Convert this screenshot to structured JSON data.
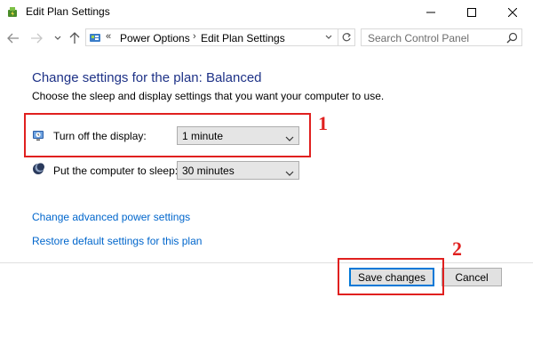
{
  "window": {
    "title": "Edit Plan Settings",
    "controls": [
      "minimize",
      "maximize",
      "close"
    ]
  },
  "navigation": {
    "breadcrumb_chevrons": "«",
    "breadcrumbs": [
      "Power Options",
      "Edit Plan Settings"
    ],
    "breadcrumb_separator": "›",
    "search_placeholder": "Search Control Panel"
  },
  "main": {
    "title": "Change settings for the plan: Balanced",
    "description": "Choose the sleep and display settings that you want your computer to use.",
    "settings": [
      {
        "label": "Turn off the display:",
        "value": "1 minute",
        "icon": "display-clock-icon"
      },
      {
        "label": "Put the computer to sleep:",
        "value": "30 minutes",
        "icon": "moon-sleep-icon"
      }
    ],
    "links": [
      "Change advanced power settings",
      "Restore default settings for this plan"
    ]
  },
  "footer": {
    "save_label": "Save changes",
    "cancel_label": "Cancel"
  },
  "annotations": {
    "marker_1": "1",
    "marker_2": "2"
  },
  "colors": {
    "title_blue": "#1e3287",
    "link_blue": "#0066cc",
    "highlight_red": "#e0201f",
    "button_focus": "#0078d7"
  }
}
